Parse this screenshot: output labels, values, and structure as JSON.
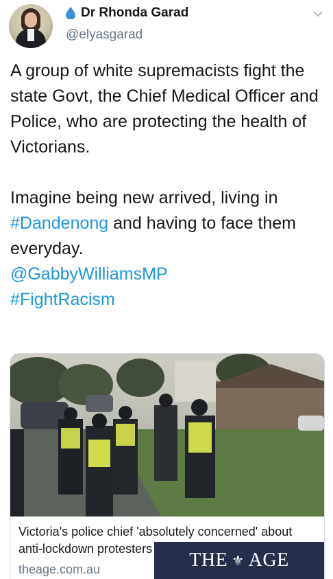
{
  "header": {
    "name": "Dr Rhonda Garad",
    "handle": "@elyasgarad"
  },
  "tweet": {
    "line1": "A group of white supremacists fight the state Govt, the Chief Medical Officer and Police, who are protecting the health of Victorians.",
    "line2_pre": "Imagine being new arrived, living in ",
    "hashtag1": "#Dandenong",
    "line2_post": " and having to face them everyday.",
    "mention": "@GabbyWilliamsMP",
    "hashtag2": "#FightRacism"
  },
  "card": {
    "brand_left": "THE",
    "brand_right": "AGE",
    "brand_crest": "⚜",
    "title": "Victoria's police chief 'absolutely concerned' about anti-lockdown protesters",
    "domain": "theage.com.au"
  },
  "colors": {
    "link": "#1b95e0",
    "secondary_text": "#657786",
    "drop_icon": "#3b94d9"
  },
  "icons": {
    "drop": "water-drop-icon",
    "more": "chevron-down-icon"
  }
}
